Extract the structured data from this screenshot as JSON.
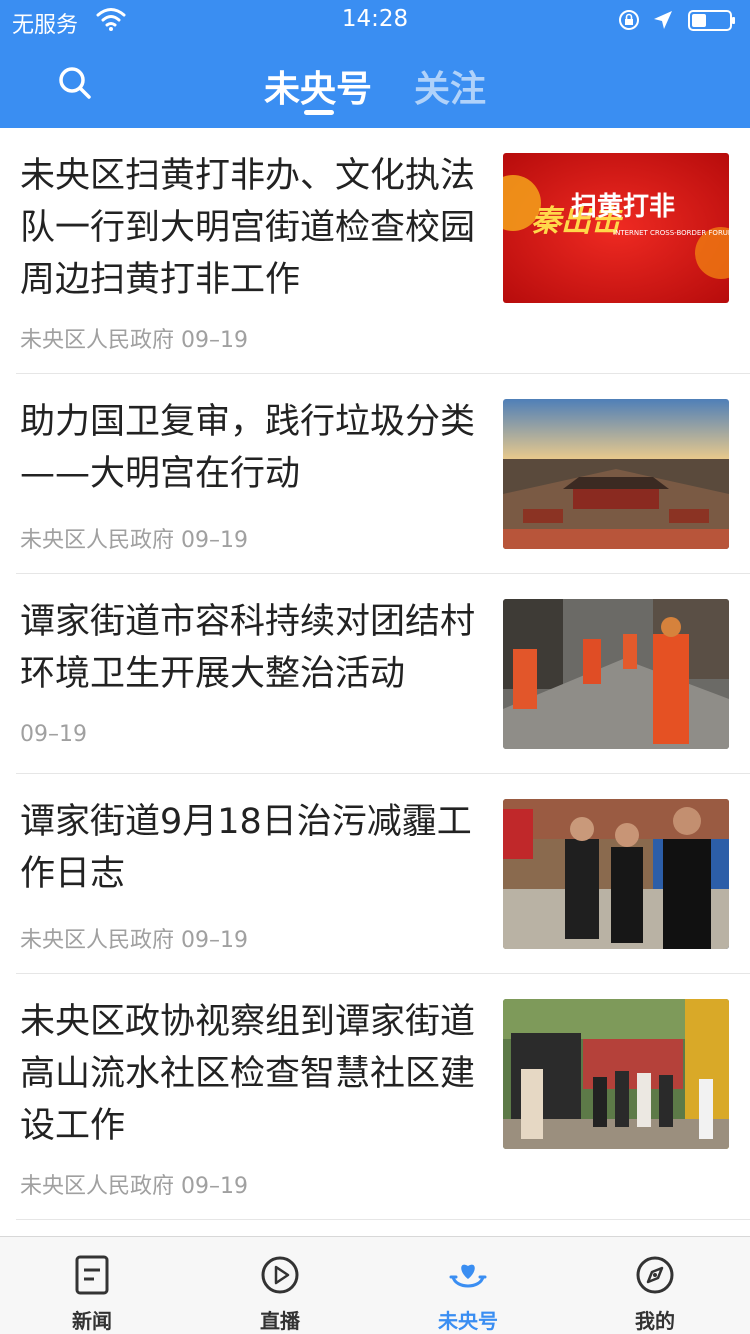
{
  "status_bar": {
    "carrier": "无服务",
    "time": "14:28"
  },
  "header": {
    "tabs": [
      {
        "label": "未央号",
        "active": true
      },
      {
        "label": "关注",
        "active": false
      }
    ],
    "accent_color": "#3a8ef2"
  },
  "feed": [
    {
      "title": "未央区扫黄打非办、文化执法队一行到大明宫街道检查校园周边扫黄打非工作",
      "source": "未央区人民政府",
      "date": "09–19",
      "thumb_text": "扫黄打非",
      "thumb_sub": "INTERNET CROSS-BORDER FORUM"
    },
    {
      "title": "助力国卫复审，践行垃圾分类——大明宫在行动",
      "source": "未央区人民政府",
      "date": "09–19"
    },
    {
      "title": "谭家街道市容科持续对团结村环境卫生开展大整治活动",
      "source": "",
      "date": "09–19"
    },
    {
      "title": "谭家街道9月18日治污减霾工作日志",
      "source": "未央区人民政府",
      "date": "09–19"
    },
    {
      "title": "未央区政协视察组到谭家街道高山流水社区检查智慧社区建设工作",
      "source": "未央区人民政府",
      "date": "09–19"
    }
  ],
  "tabbar": {
    "items": [
      {
        "label": "新闻",
        "icon": "news-icon"
      },
      {
        "label": "直播",
        "icon": "live-play-icon"
      },
      {
        "label": "未央号",
        "icon": "weiyang-heart-icon",
        "active": true
      },
      {
        "label": "我的",
        "icon": "compass-icon"
      }
    ]
  }
}
